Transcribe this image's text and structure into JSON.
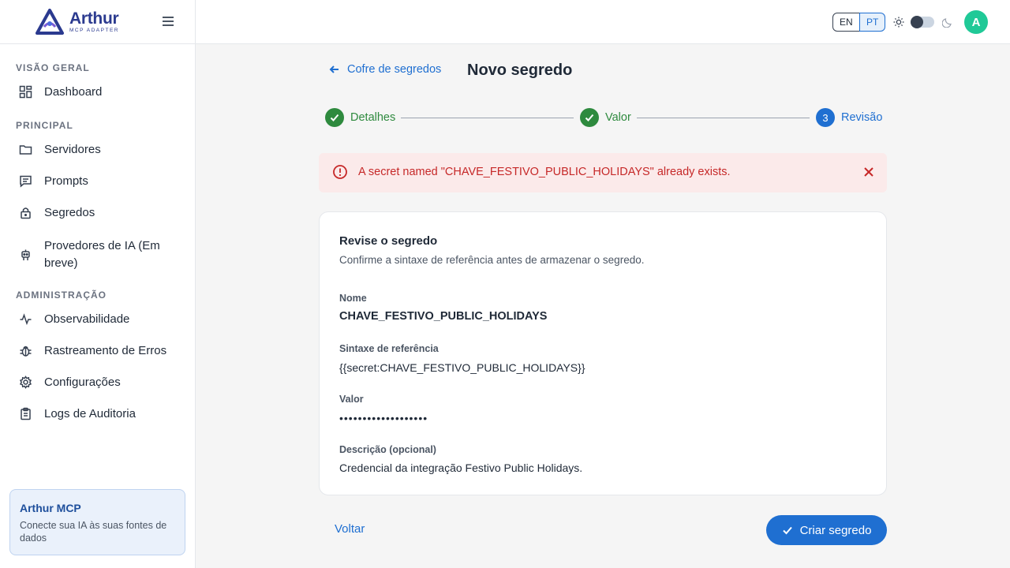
{
  "app": {
    "logo_name": "Arthur",
    "logo_sub": "MCP ADAPTER"
  },
  "sidebar": {
    "sections": {
      "overview": "VISÃO GERAL",
      "principal": "PRINCIPAL",
      "admin": "ADMINISTRAÇÃO"
    },
    "items": [
      {
        "label": "Dashboard",
        "icon": "dashboard-icon"
      },
      {
        "label": "Servidores",
        "icon": "folder-icon"
      },
      {
        "label": "Prompts",
        "icon": "message-icon"
      },
      {
        "label": "Segredos",
        "icon": "lock-icon"
      },
      {
        "label": "Provedores de IA (Em",
        "label2": "breve)",
        "icon": "robot-icon"
      },
      {
        "label": "Observabilidade",
        "icon": "activity-icon"
      },
      {
        "label": "Rastreamento de Erros",
        "icon": "bug-icon"
      },
      {
        "label": "Configurações",
        "icon": "gear-icon"
      },
      {
        "label": "Logs de Auditoria",
        "icon": "clipboard-icon"
      }
    ],
    "promo": {
      "title": "Arthur MCP",
      "subtitle": "Conecte sua IA às suas fontes de dados"
    }
  },
  "topbar": {
    "lang_en": "EN",
    "lang_pt": "PT",
    "selected_lang": "PT",
    "theme": "light",
    "avatar_initial": "A"
  },
  "main": {
    "back_label": "Cofre de segredos",
    "title": "Novo segredo",
    "steps": [
      {
        "label": "Detalhes",
        "status": "done"
      },
      {
        "label": "Valor",
        "status": "done"
      },
      {
        "number": "3",
        "label": "Revisão",
        "status": "active"
      }
    ],
    "alert": {
      "message": "A secret named \"CHAVE_FESTIVO_PUBLIC_HOLIDAYS\" already exists."
    },
    "card": {
      "title": "Revise o segredo",
      "subtitle": "Confirme a sintaxe de referência antes de armazenar o segredo.",
      "fields": [
        {
          "label": "Nome",
          "value": "CHAVE_FESTIVO_PUBLIC_HOLIDAYS"
        },
        {
          "label": "Sintaxe de referência",
          "value": "{{secret:CHAVE_FESTIVO_PUBLIC_HOLIDAYS}}"
        },
        {
          "label": "Valor",
          "value": "•••••••••••••••••••"
        },
        {
          "label": "Descrição (opcional)",
          "value": "Credencial da integração Festivo Public Holidays."
        }
      ]
    },
    "back_button": "Voltar",
    "create_button": "Criar segredo"
  },
  "colors": {
    "primary": "#1f6fd1",
    "success": "#2e8a3e",
    "error": "#c62828",
    "avatar": "#20c997"
  }
}
